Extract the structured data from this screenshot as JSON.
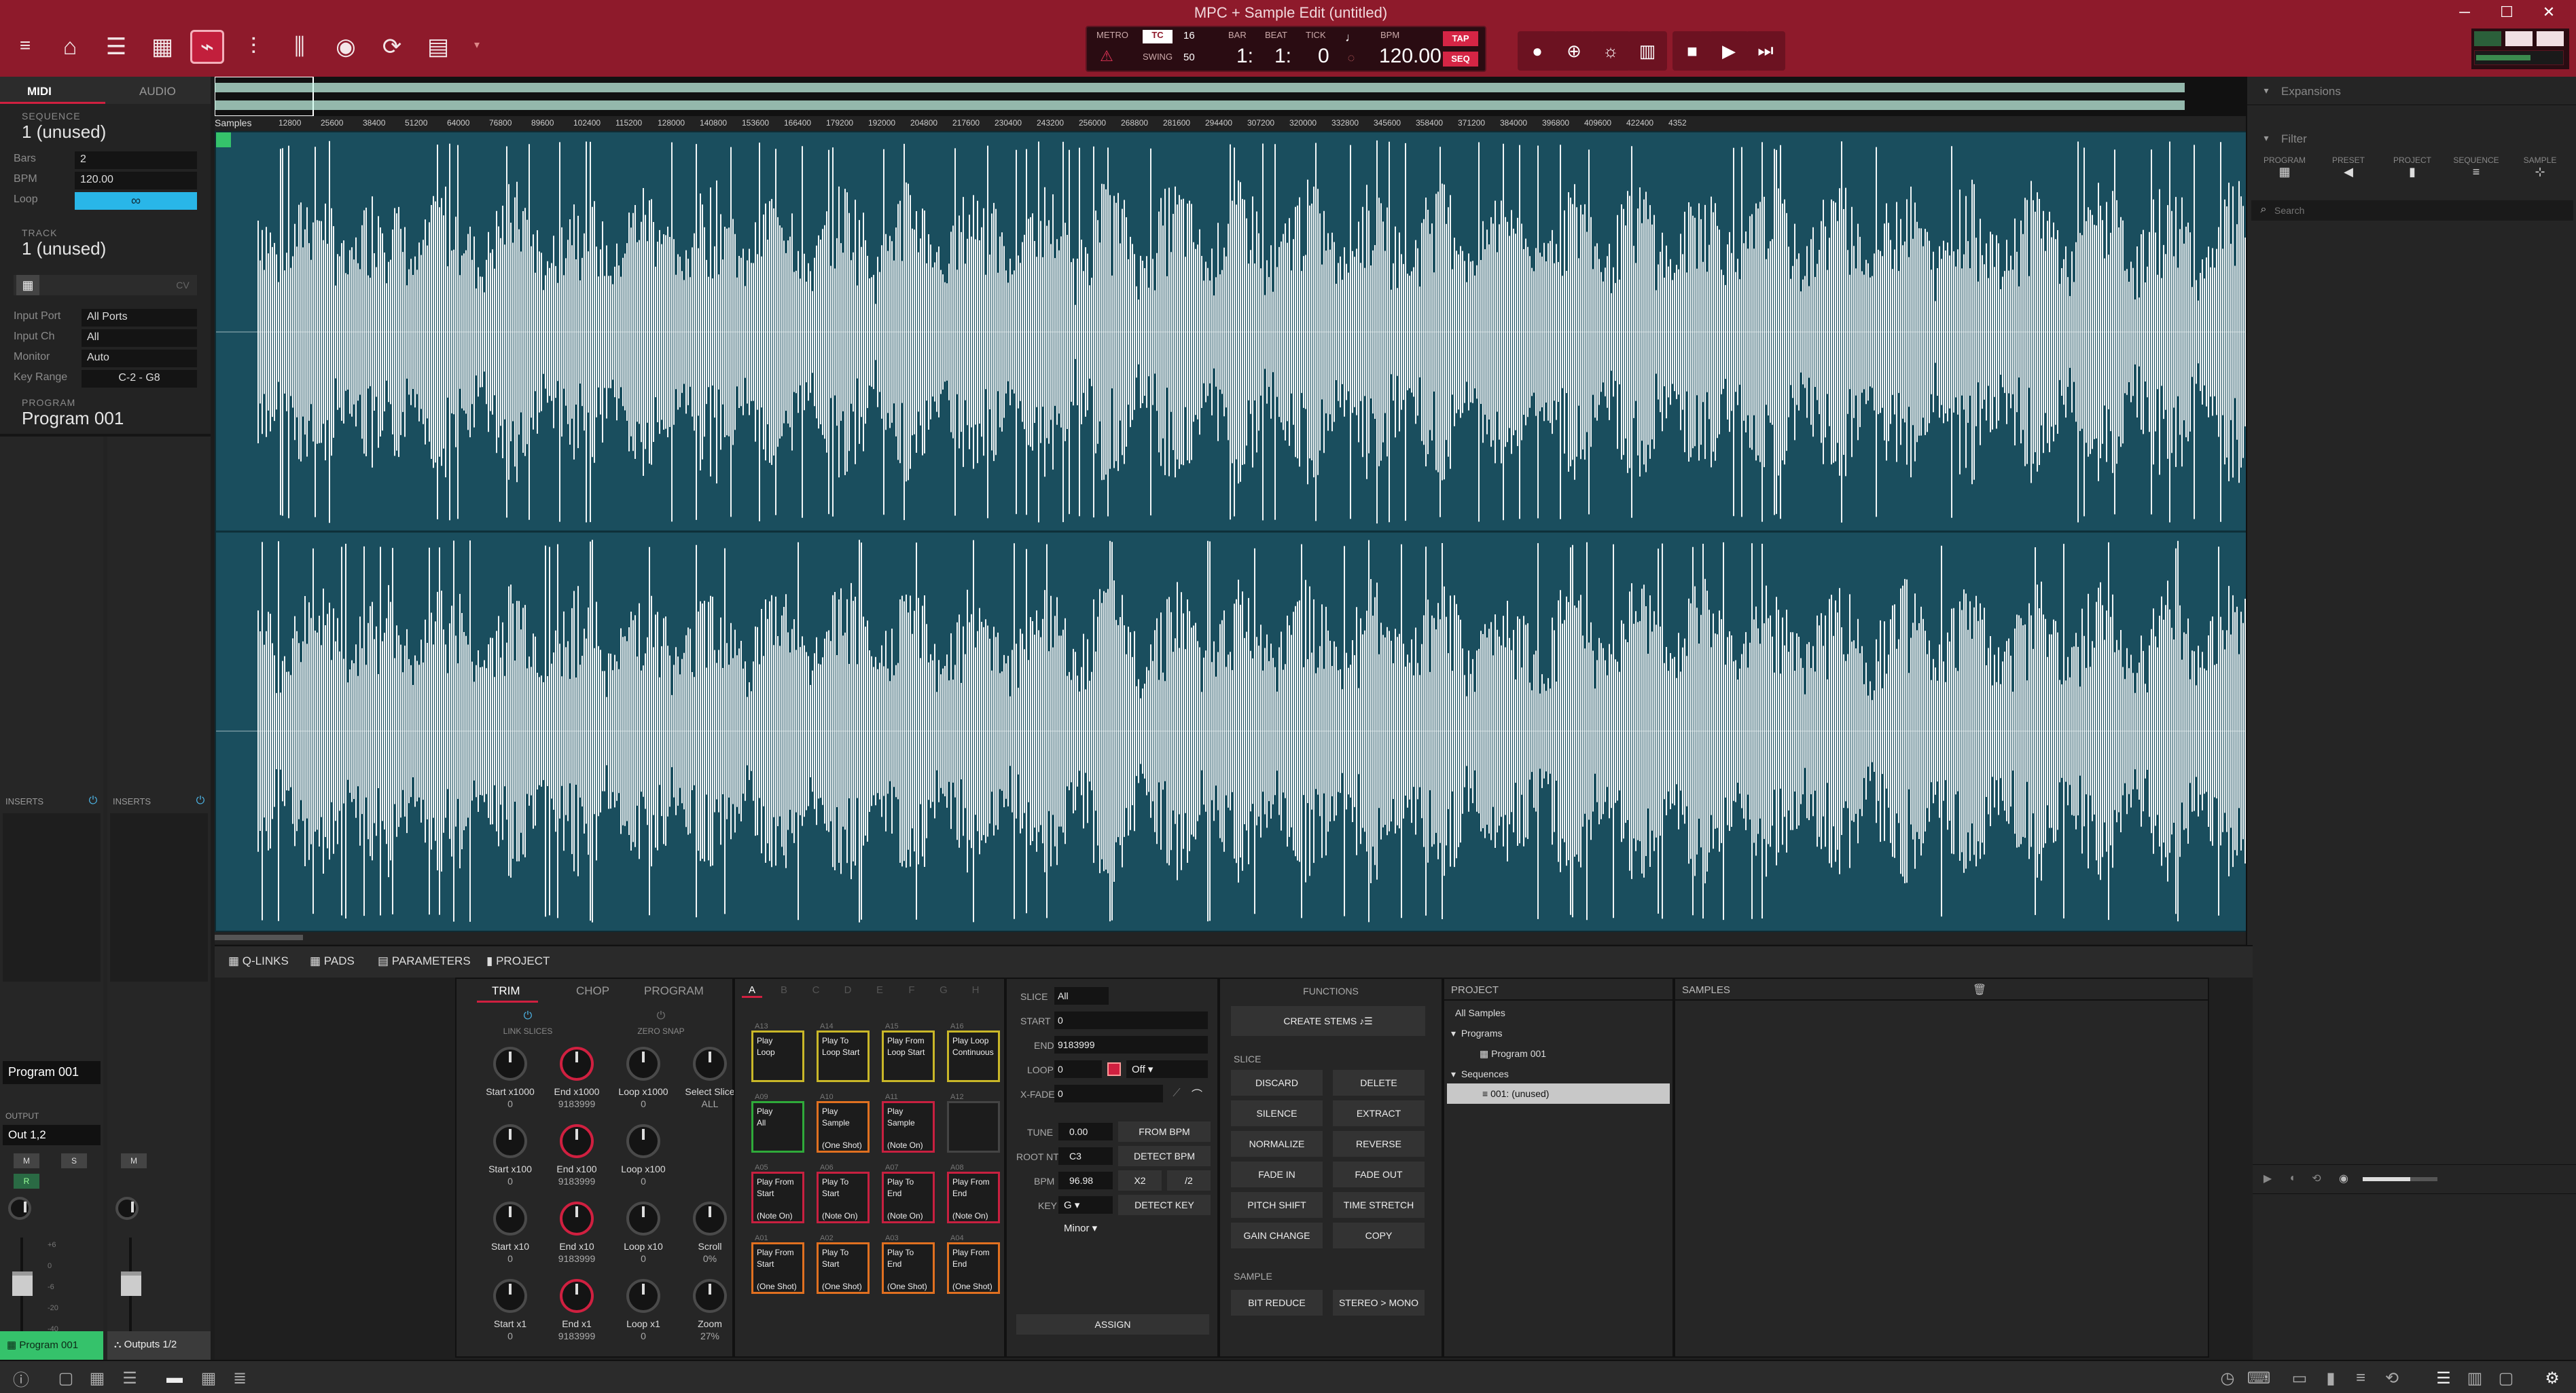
{
  "window": {
    "title": "MPC + Sample Edit (untitled)",
    "controls": [
      "─",
      "☐",
      "✕"
    ]
  },
  "toolbar": {
    "icons": [
      "menu-icon",
      "home-icon",
      "main-icon",
      "grid-icon",
      "sample-edit-icon",
      "mixer-icon",
      "channel-mixer-icon",
      "record-icon",
      "looper-icon",
      "song-icon"
    ]
  },
  "transport": {
    "metro_label": "METRO",
    "tc_label": "TC",
    "tc_value": "16",
    "swing_label": "SWING",
    "swing_value": "50",
    "bar_label": "BAR",
    "beat_label": "BEAT",
    "tick_label": "TICK",
    "bar_value": "1:",
    "beat_value": "1:",
    "tick_value": "0",
    "bpm_label": "BPM",
    "bpm_value": "120.00",
    "tap_label": "TAP",
    "seq_label": "SEQ"
  },
  "left": {
    "midi_tab": "MIDI",
    "audio_tab": "AUDIO",
    "sequence_header": "SEQUENCE",
    "sequence_name": "1 (unused)",
    "bars_label": "Bars",
    "bars_value": "2",
    "bpm_label": "BPM",
    "bpm_value": "120.00",
    "loop_label": "Loop",
    "track_header": "TRACK",
    "track_name": "1 (unused)",
    "input_port_label": "Input Port",
    "input_port_value": "All Ports",
    "input_ch_label": "Input Ch",
    "input_ch_value": "All",
    "monitor_label": "Monitor",
    "monitor_value": "Auto",
    "key_range_label": "Key Range",
    "key_range_value": "C-2 - G8",
    "program_header": "PROGRAM",
    "program_name": "Program 001",
    "inserts_label": "INSERTS",
    "inserts2_label": "INSERTS",
    "channel_program": "Program 001",
    "output_label": "OUTPUT",
    "output_value": "Out 1,2",
    "m_label": "M",
    "s_label": "S",
    "r_label": "R",
    "fader_scale": [
      "+6",
      "0",
      "-6",
      "-20",
      "-40"
    ],
    "strip1_label": "Program 001",
    "strip2_label": "Outputs 1/2"
  },
  "ruler": {
    "samples_label": "Samples",
    "ticks": [
      "12800",
      "25600",
      "38400",
      "51200",
      "64000",
      "76800",
      "89600",
      "102400",
      "115200",
      "128000",
      "140800",
      "153600",
      "166400",
      "179200",
      "192000",
      "204800",
      "217600",
      "230400",
      "243200",
      "256000",
      "268800",
      "281600",
      "294400",
      "307200",
      "320000",
      "332800",
      "345600",
      "358400",
      "371200",
      "384000",
      "396800",
      "409600",
      "422400",
      "4352"
    ]
  },
  "right": {
    "expansions": "Expansions",
    "filter": "Filter",
    "filter_types": [
      "PROGRAM",
      "PRESET",
      "PROJECT",
      "SEQUENCE",
      "SAMPLE"
    ],
    "search_placeholder": "Search"
  },
  "tabs": {
    "qlinks": "Q-LINKS",
    "pads": "PADS",
    "parameters": "PARAMETERS",
    "project": "PROJECT"
  },
  "trim": {
    "tabs": [
      "TRIM",
      "CHOP",
      "PROGRAM"
    ],
    "link_slices": "LINK SLICES",
    "zero_snap": "ZERO SNAP",
    "knobs": [
      {
        "label": "Start x1000",
        "value": "0",
        "red": false
      },
      {
        "label": "End x1000",
        "value": "9183999",
        "red": true
      },
      {
        "label": "Loop x1000",
        "value": "0",
        "red": false
      },
      {
        "label": "Select Slice",
        "value": "ALL",
        "red": false
      },
      {
        "label": "Start x100",
        "value": "0",
        "red": false
      },
      {
        "label": "End x100",
        "value": "9183999",
        "red": true
      },
      {
        "label": "Loop x100",
        "value": "0",
        "red": false
      },
      {
        "label": "",
        "value": "",
        "red": false
      },
      {
        "label": "Start x10",
        "value": "0",
        "red": false
      },
      {
        "label": "End x10",
        "value": "9183999",
        "red": true
      },
      {
        "label": "Loop x10",
        "value": "0",
        "red": false
      },
      {
        "label": "Scroll",
        "value": "0%",
        "red": false
      },
      {
        "label": "Start x1",
        "value": "0",
        "red": false
      },
      {
        "label": "End x1",
        "value": "9183999",
        "red": true
      },
      {
        "label": "Loop x1",
        "value": "0",
        "red": false
      },
      {
        "label": "Zoom",
        "value": "27%",
        "red": false
      }
    ]
  },
  "pads": {
    "banks": [
      "A",
      "B",
      "C",
      "D",
      "E",
      "F",
      "G",
      "H"
    ],
    "rows": [
      [
        {
          "id": "A13",
          "text": "Play\nLoop",
          "color": "#c9b728"
        },
        {
          "id": "A14",
          "text": "Play To\nLoop Start",
          "color": "#c9b728"
        },
        {
          "id": "A15",
          "text": "Play From\nLoop Start",
          "color": "#c9b728"
        },
        {
          "id": "A16",
          "text": "Play Loop\nContinuous",
          "color": "#c9b728"
        }
      ],
      [
        {
          "id": "A09",
          "text": "Play\nAll",
          "color": "#2faa3a"
        },
        {
          "id": "A10",
          "text": "Play\nSample\n\n(One Shot)",
          "color": "#e07020"
        },
        {
          "id": "A11",
          "text": "Play\nSample\n\n(Note On)",
          "color": "#c82040"
        },
        {
          "id": "A12",
          "text": "",
          "color": "#444444"
        }
      ],
      [
        {
          "id": "A05",
          "text": "Play From\nStart\n\n(Note On)",
          "color": "#c82040"
        },
        {
          "id": "A06",
          "text": "Play To\nStart\n\n(Note On)",
          "color": "#c82040"
        },
        {
          "id": "A07",
          "text": "Play To\nEnd\n\n(Note On)",
          "color": "#c82040"
        },
        {
          "id": "A08",
          "text": "Play From\nEnd\n\n(Note On)",
          "color": "#c82040"
        }
      ],
      [
        {
          "id": "A01",
          "text": "Play From\nStart\n\n(One Shot)",
          "color": "#e07020"
        },
        {
          "id": "A02",
          "text": "Play To\nStart\n\n(One Shot)",
          "color": "#e07020"
        },
        {
          "id": "A03",
          "text": "Play To\nEnd\n\n(One Shot)",
          "color": "#e07020"
        },
        {
          "id": "A04",
          "text": "Play From\nEnd\n\n(One Shot)",
          "color": "#e07020"
        }
      ]
    ]
  },
  "params": {
    "slice_label": "SLICE",
    "slice_value": "All",
    "start_label": "START",
    "start_value": "0",
    "end_label": "END",
    "end_value": "9183999",
    "loop_label": "LOOP",
    "loop_value": "0",
    "loop_mode": "Off",
    "xfade_label": "X-FADE",
    "xfade_value": "0",
    "tune_label": "TUNE",
    "tune_value": "0.00",
    "root_label": "ROOT NT",
    "root_value": "C3",
    "bpm_label": "BPM",
    "bpm_value": "96.98",
    "key_label": "KEY",
    "key_value": "G",
    "scale_value": "Minor",
    "from_bpm": "FROM BPM",
    "detect_bpm": "DETECT BPM",
    "x2": "X2",
    "div2": "/2",
    "detect_key": "DETECT KEY",
    "assign": "ASSIGN"
  },
  "functions": {
    "header": "FUNCTIONS",
    "create_stems": "CREATE STEMS",
    "slice_header": "SLICE",
    "slice_buttons": [
      "DISCARD",
      "DELETE",
      "SILENCE",
      "EXTRACT",
      "NORMALIZE",
      "REVERSE",
      "FADE IN",
      "FADE OUT",
      "PITCH SHIFT",
      "TIME STRETCH",
      "GAIN CHANGE",
      "COPY"
    ],
    "sample_header": "SAMPLE",
    "sample_buttons": [
      "BIT REDUCE",
      "STEREO > MONO"
    ]
  },
  "project": {
    "header": "PROJECT",
    "all_samples": "All Samples",
    "programs": "Programs",
    "program_item": "Program 001",
    "sequences": "Sequences",
    "sequence_item": "001: (unused)",
    "samples_header": "SAMPLES"
  },
  "colors": {
    "titlebar": "#8e1a2b",
    "accent_red": "#c21f3c",
    "wave_bg": "#1a4e5e",
    "loop_blue": "#29b6e8",
    "green": "#35c26b"
  }
}
